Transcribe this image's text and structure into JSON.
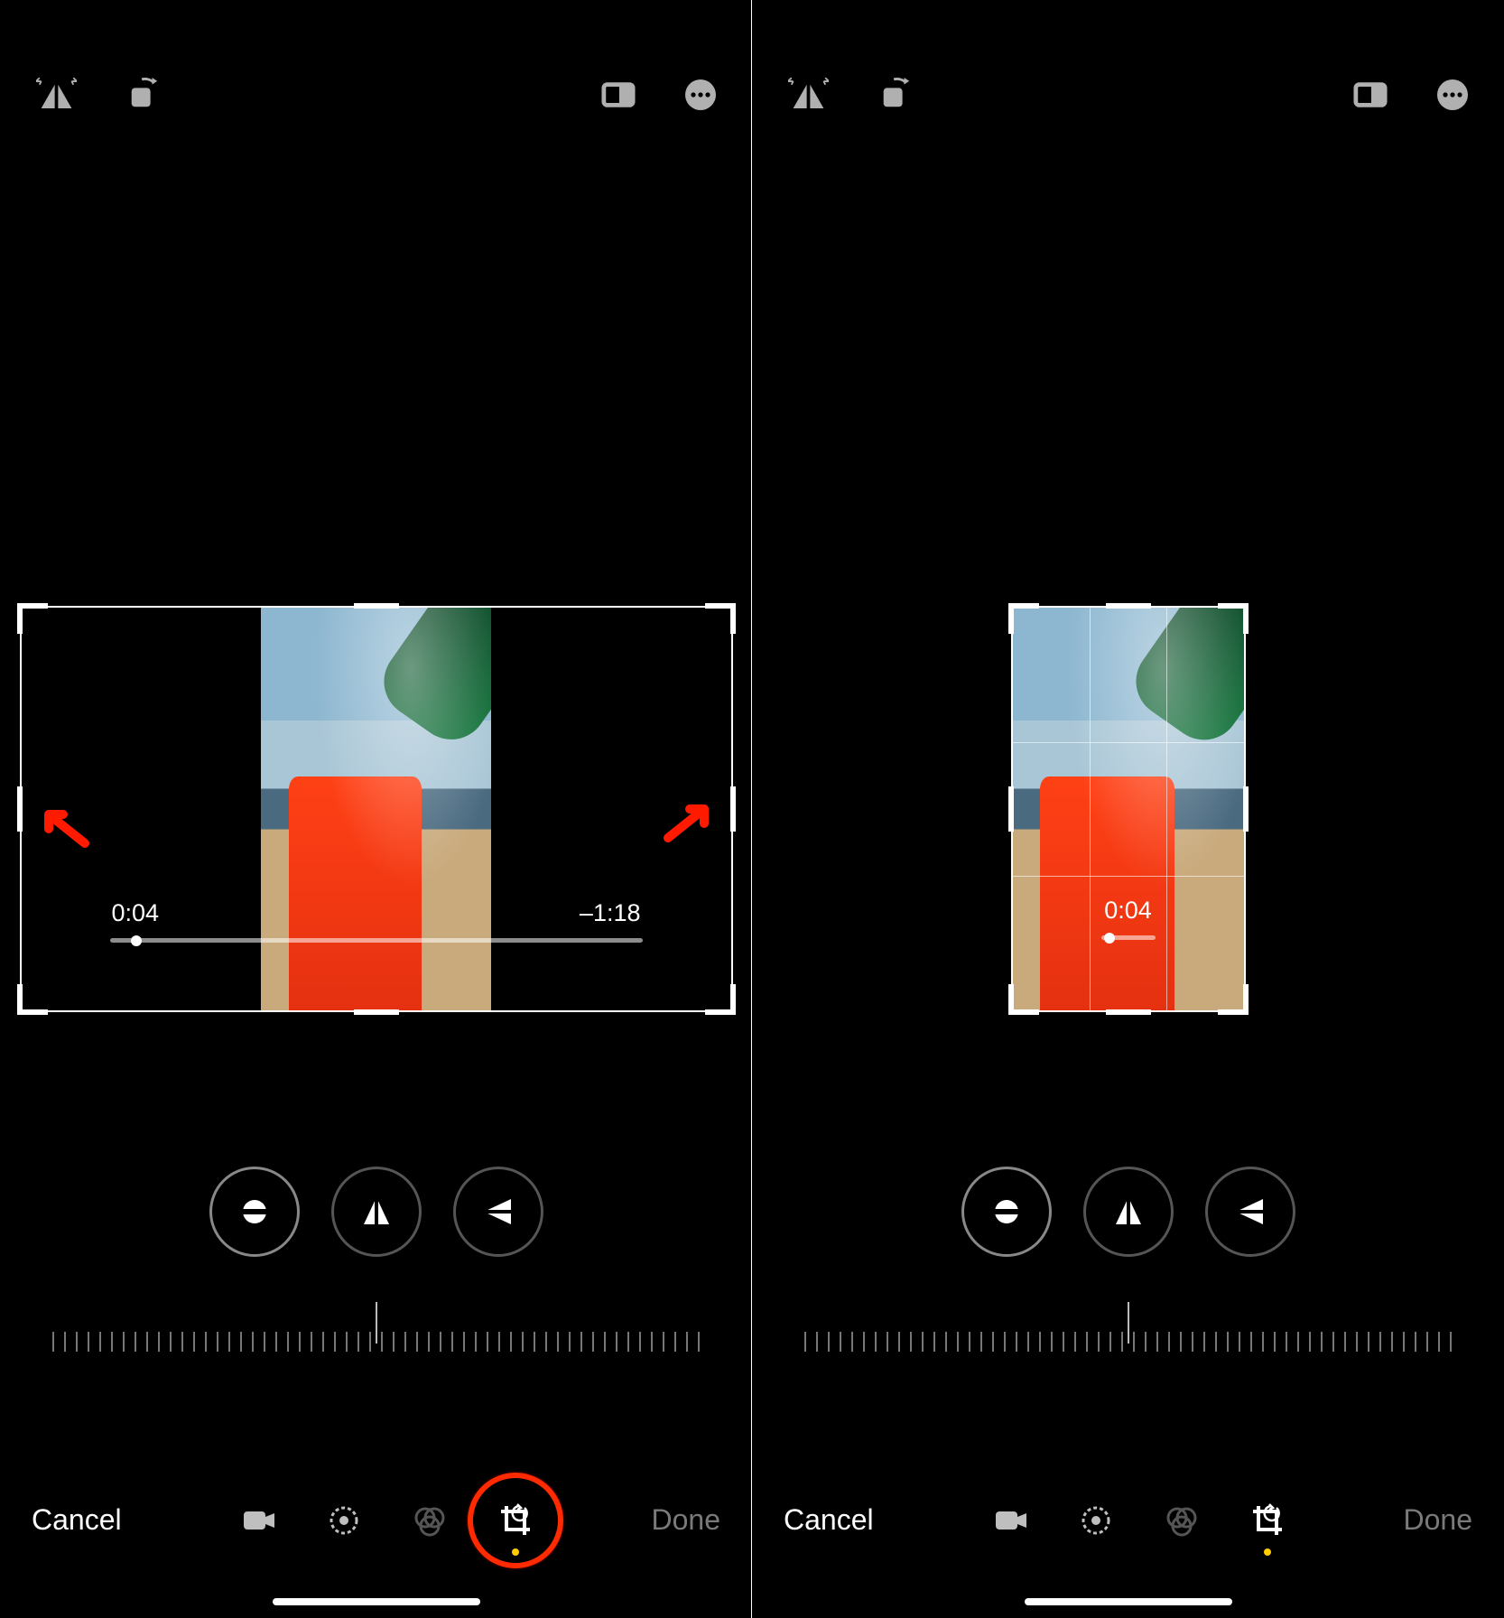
{
  "panel_left": {
    "playback_current": "0:04",
    "playback_remaining": "–1:18",
    "cancel_label": "Cancel",
    "done_label": "Done"
  },
  "panel_right": {
    "playback_current": "0:04",
    "cancel_label": "Cancel",
    "done_label": "Done"
  },
  "icons": {
    "flip": "flip-horizontal-icon",
    "rotate": "rotate-icon",
    "aspect": "aspect-ratio-icon",
    "more": "more-icon",
    "straighten": "straighten-icon",
    "perspective_v": "perspective-vertical-icon",
    "perspective_h": "perspective-horizontal-icon",
    "tab_video": "video-tab-icon",
    "tab_adjust": "adjust-tab-icon",
    "tab_filters": "filters-tab-icon",
    "tab_crop": "crop-tab-icon"
  },
  "colors": {
    "accent_yellow": "#ffcc00",
    "annotation_red": "#ff2a00"
  }
}
